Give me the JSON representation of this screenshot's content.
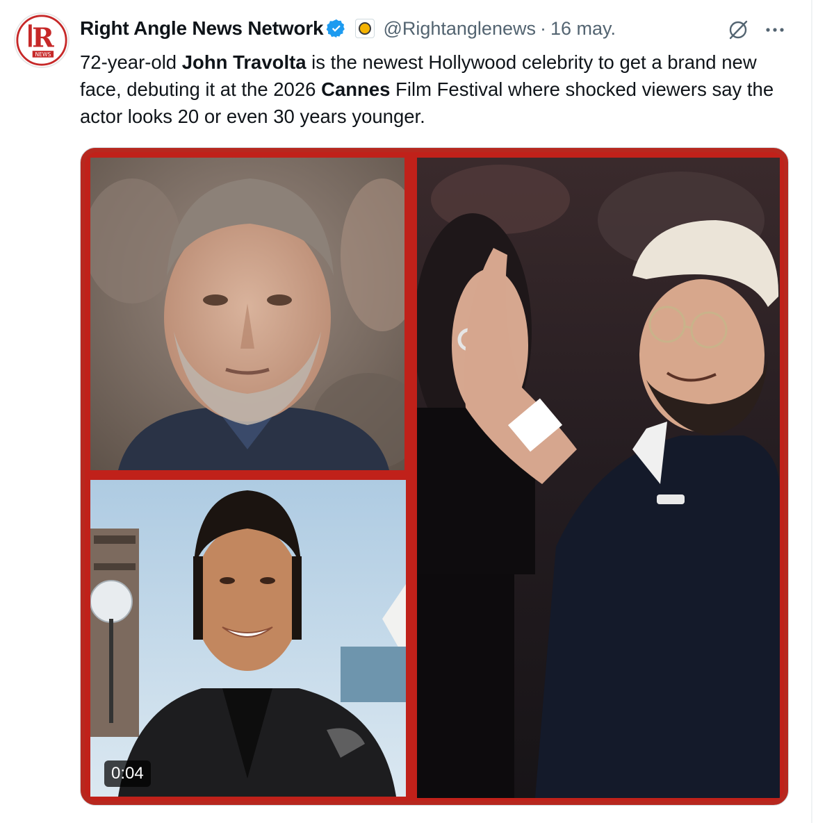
{
  "author": {
    "display_name": "Right Angle News Network",
    "handle": "@Rightanglenews",
    "separator": "·",
    "date": "16 may.",
    "avatar_icon": "right-angle-news-logo",
    "verified_icon": "verified-badge-icon",
    "affiliate_icon": "affiliate-badge-icon"
  },
  "actions": {
    "grok_icon": "grok-icon",
    "more_icon": "more-icon"
  },
  "text": {
    "part1": "72-year-old ",
    "bold1": "John Travolta",
    "part2": " is the newest Hollywood celebrity to get a brand new face, debuting it at the 2026 ",
    "bold2": "Cannes",
    "part3": " Film Festival where shocked viewers say the actor looks 20 or even 30 years younger."
  },
  "media": {
    "video_duration": "0:04",
    "frame_color": "#b7281f"
  },
  "colors": {
    "verified_blue": "#1d9bf0",
    "secondary_text": "#536471",
    "primary_text": "#0f1419"
  }
}
